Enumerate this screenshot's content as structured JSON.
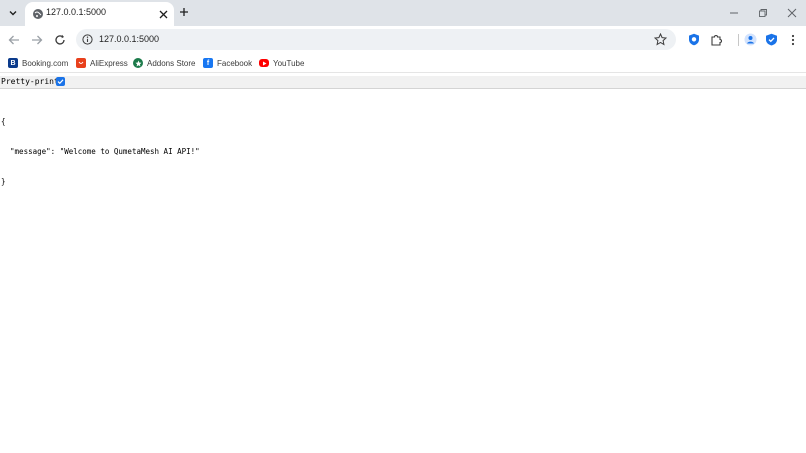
{
  "browser": {
    "tab": {
      "title": "127.0.0.1:5000"
    },
    "new_tab_symbol": "+",
    "window_controls": [
      "minimize",
      "restore",
      "close"
    ],
    "address_bar": {
      "url": "127.0.0.1:5000"
    },
    "bookmarks": [
      {
        "label": "Booking.com",
        "icon": "booking-icon",
        "color": "#0b3b8c",
        "glyph": "B"
      },
      {
        "label": "AliExpress",
        "icon": "aliexpress-icon",
        "color": "#e8401c",
        "glyph": ""
      },
      {
        "label": "Addons Store",
        "icon": "addons-store-icon",
        "color": "#1b7a4a",
        "glyph": ""
      },
      {
        "label": "Facebook",
        "icon": "facebook-icon",
        "color": "#1877f2",
        "glyph": "f"
      },
      {
        "label": "YouTube",
        "icon": "youtube-icon",
        "color": "#ff0000",
        "glyph": ""
      }
    ]
  },
  "page": {
    "pretty_print_label": "Pretty-print",
    "pretty_print_checked": true,
    "json_lines": [
      "{",
      "  \"message\": \"Welcome to QumetaMesh AI API!\"",
      "}"
    ]
  },
  "colors": {
    "tabstrip_bg": "#dfe3e8",
    "accent": "#1a73e8"
  }
}
